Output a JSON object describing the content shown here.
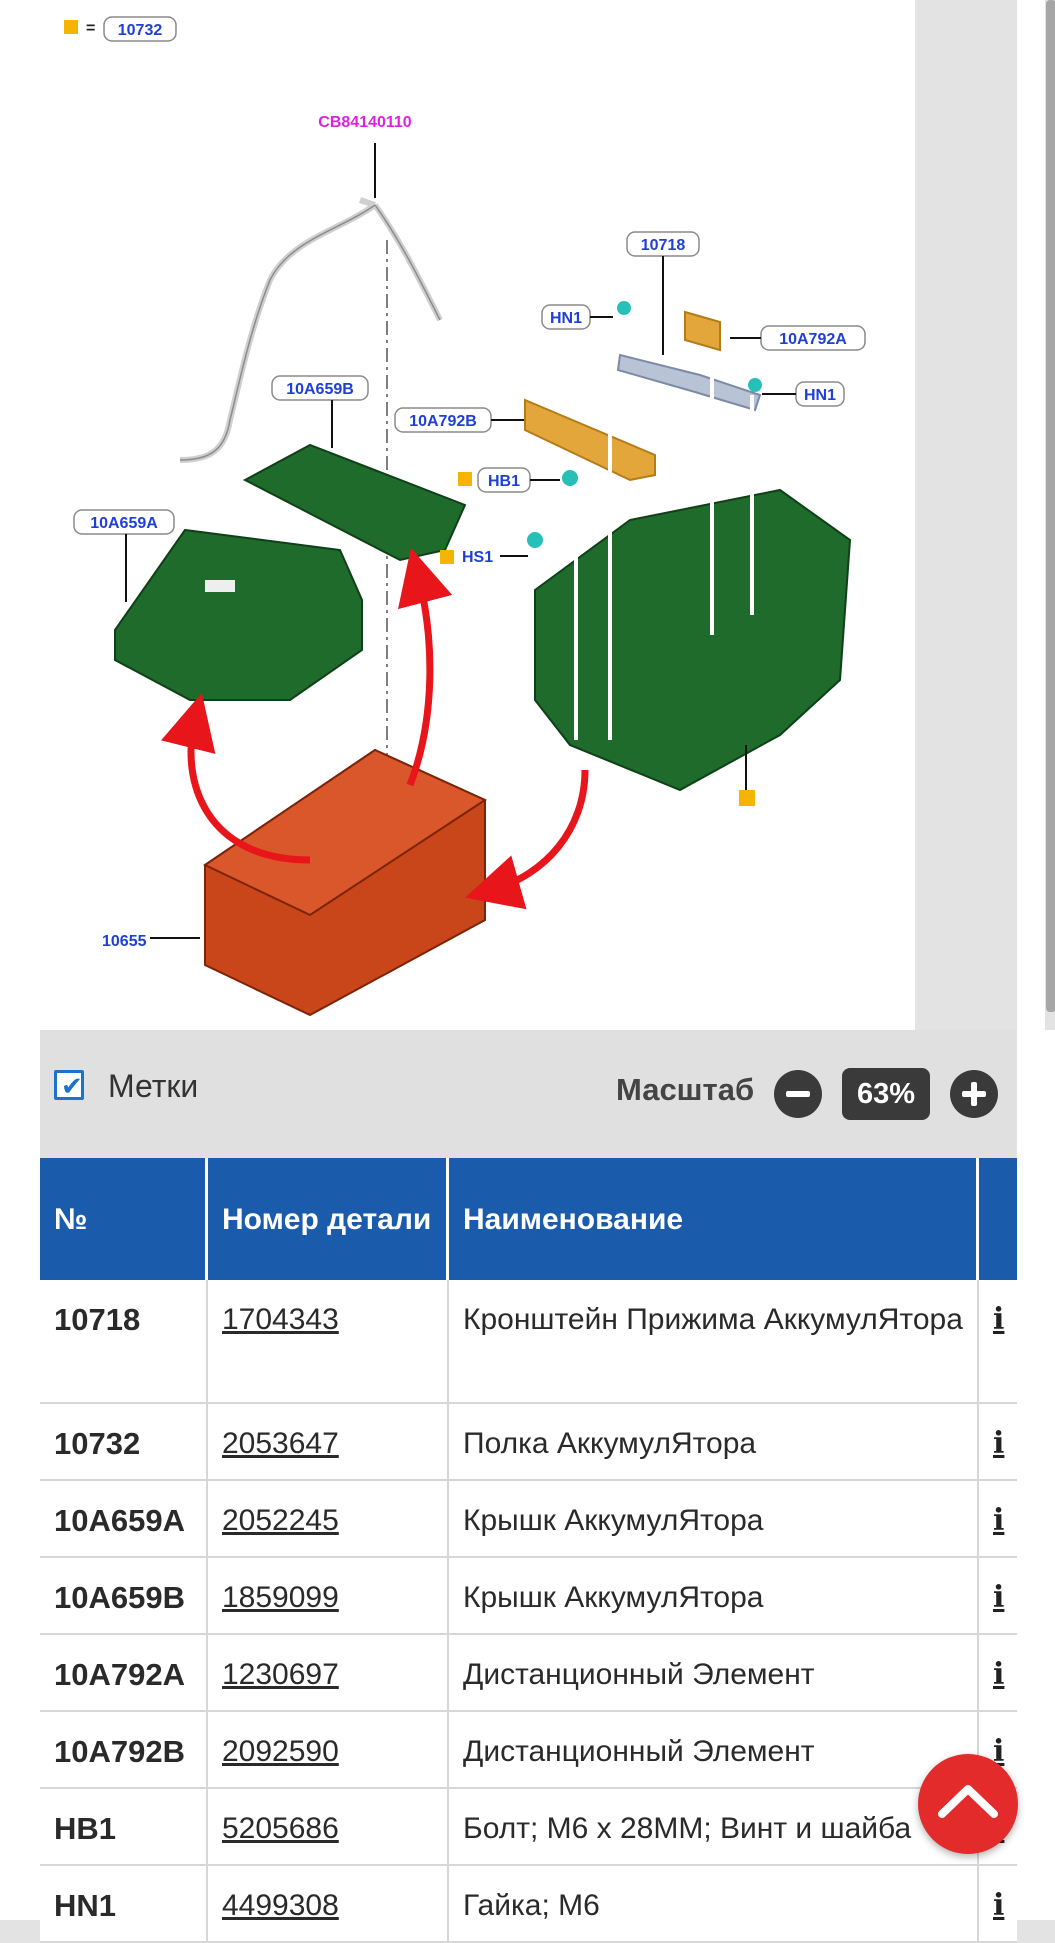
{
  "diagram": {
    "legend_code": "10732",
    "main_code": "CB84140110",
    "callouts": {
      "c10718": "10718",
      "hn1_a": "HN1",
      "c10a792a": "10A792A",
      "hn1_b": "HN1",
      "c10a659b": "10A659B",
      "c10a792b": "10A792B",
      "hb1": "HB1",
      "c10a659a": "10A659A",
      "hs1": "HS1",
      "c10655": "10655"
    },
    "colors": {
      "callout_text": "#1f3fd6",
      "main_code": "#e020e0",
      "marker": "#f4b400",
      "housing": "#1e6b2c",
      "battery": "#c8461a",
      "arrow": "#e8151b"
    }
  },
  "controls": {
    "labels_checkbox": "Метки",
    "labels_checked": true,
    "zoom_label": "Масштаб",
    "zoom_value": "63%"
  },
  "table": {
    "headers": [
      "№",
      "Номер детали",
      "Наименование",
      ""
    ],
    "rows": [
      {
        "no": "10718",
        "part": "1704343",
        "name": "Кронштейн Прижима АккумулЯтора",
        "info": "i"
      },
      {
        "no": "10732",
        "part": "2053647",
        "name": "Полка АккумулЯтора",
        "info": "i"
      },
      {
        "no": "10A659A",
        "part": "2052245",
        "name": "Крышк АккумулЯтора",
        "info": "i"
      },
      {
        "no": "10A659B",
        "part": "1859099",
        "name": "Крышк АккумулЯтора",
        "info": "i"
      },
      {
        "no": "10A792A",
        "part": "1230697",
        "name": "Дистанционный Элемент",
        "info": "i"
      },
      {
        "no": "10A792B",
        "part": "2092590",
        "name": "Дистанционный Элемент",
        "info": "i"
      },
      {
        "no": "HB1",
        "part": "5205686",
        "name": "Болт; M6 x 28MM; Винт и шайба",
        "info": "i"
      },
      {
        "no": "HN1",
        "part": "4499308",
        "name": "Гайка; M6",
        "info": "i"
      }
    ]
  },
  "scroll_top": {
    "icon": "chevron-up-icon"
  }
}
